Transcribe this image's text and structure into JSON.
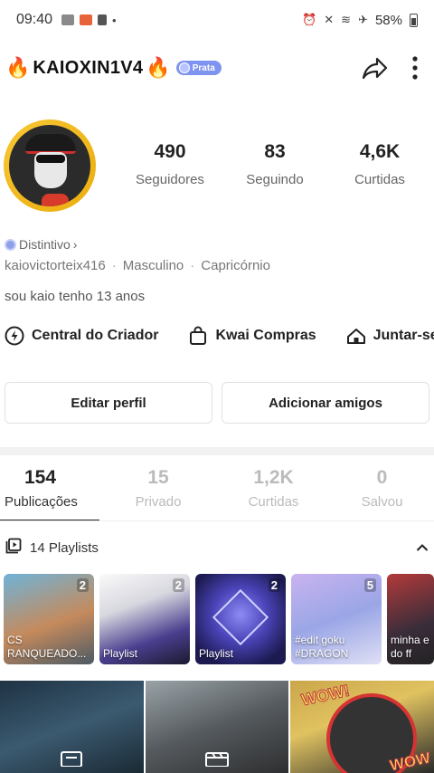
{
  "status_bar": {
    "time": "09:40",
    "battery": "58%",
    "dot": "•"
  },
  "header": {
    "fire_left": "🔥",
    "username": "KAIOXIN1V4",
    "fire_right": "🔥",
    "badge_label": "Prata",
    "badge_color": "#7f94f0"
  },
  "stats": [
    {
      "value": "490",
      "label": "Seguidores"
    },
    {
      "value": "83",
      "label": "Seguindo"
    },
    {
      "value": "4,6K",
      "label": "Curtidas"
    }
  ],
  "profile": {
    "distintivo": "Distintivo",
    "distintivo_chevron": "›",
    "handle": "kaiovictorteix416",
    "gender": "Masculino",
    "sign": "Capricórnio",
    "separator": "·",
    "bio": "sou kaio tenho 13 anos"
  },
  "shortcuts": [
    {
      "label": "Central do Criador",
      "icon": "lightning-icon"
    },
    {
      "label": "Kwai Compras",
      "icon": "shopping-bag-icon"
    },
    {
      "label": "Juntar-se à f",
      "icon": "house-icon"
    }
  ],
  "buttons": {
    "edit_profile": "Editar perfil",
    "add_friends": "Adicionar amigos"
  },
  "tabs": [
    {
      "count": "154",
      "label": "Publicações",
      "active": true
    },
    {
      "count": "15",
      "label": "Privado",
      "active": false
    },
    {
      "count": "1,2K",
      "label": "Curtidas",
      "active": false
    },
    {
      "count": "0",
      "label": "Salvou",
      "active": false
    }
  ],
  "playlists": {
    "header": "14 Playlists",
    "items": [
      {
        "count": "2",
        "caption": "CS RANQUEADO..."
      },
      {
        "count": "2",
        "caption": "Playlist"
      },
      {
        "count": "2",
        "caption": "Playlist"
      },
      {
        "count": "5",
        "caption": "#edit goku #DRAGON"
      },
      {
        "count": "",
        "caption": "minha e do ff"
      }
    ]
  },
  "grid": {
    "wow": "WOW!",
    "wow2": "WOW"
  },
  "colors": {
    "accent": "#222222",
    "muted": "#bbbbbb",
    "badge": "#7f94f0"
  }
}
